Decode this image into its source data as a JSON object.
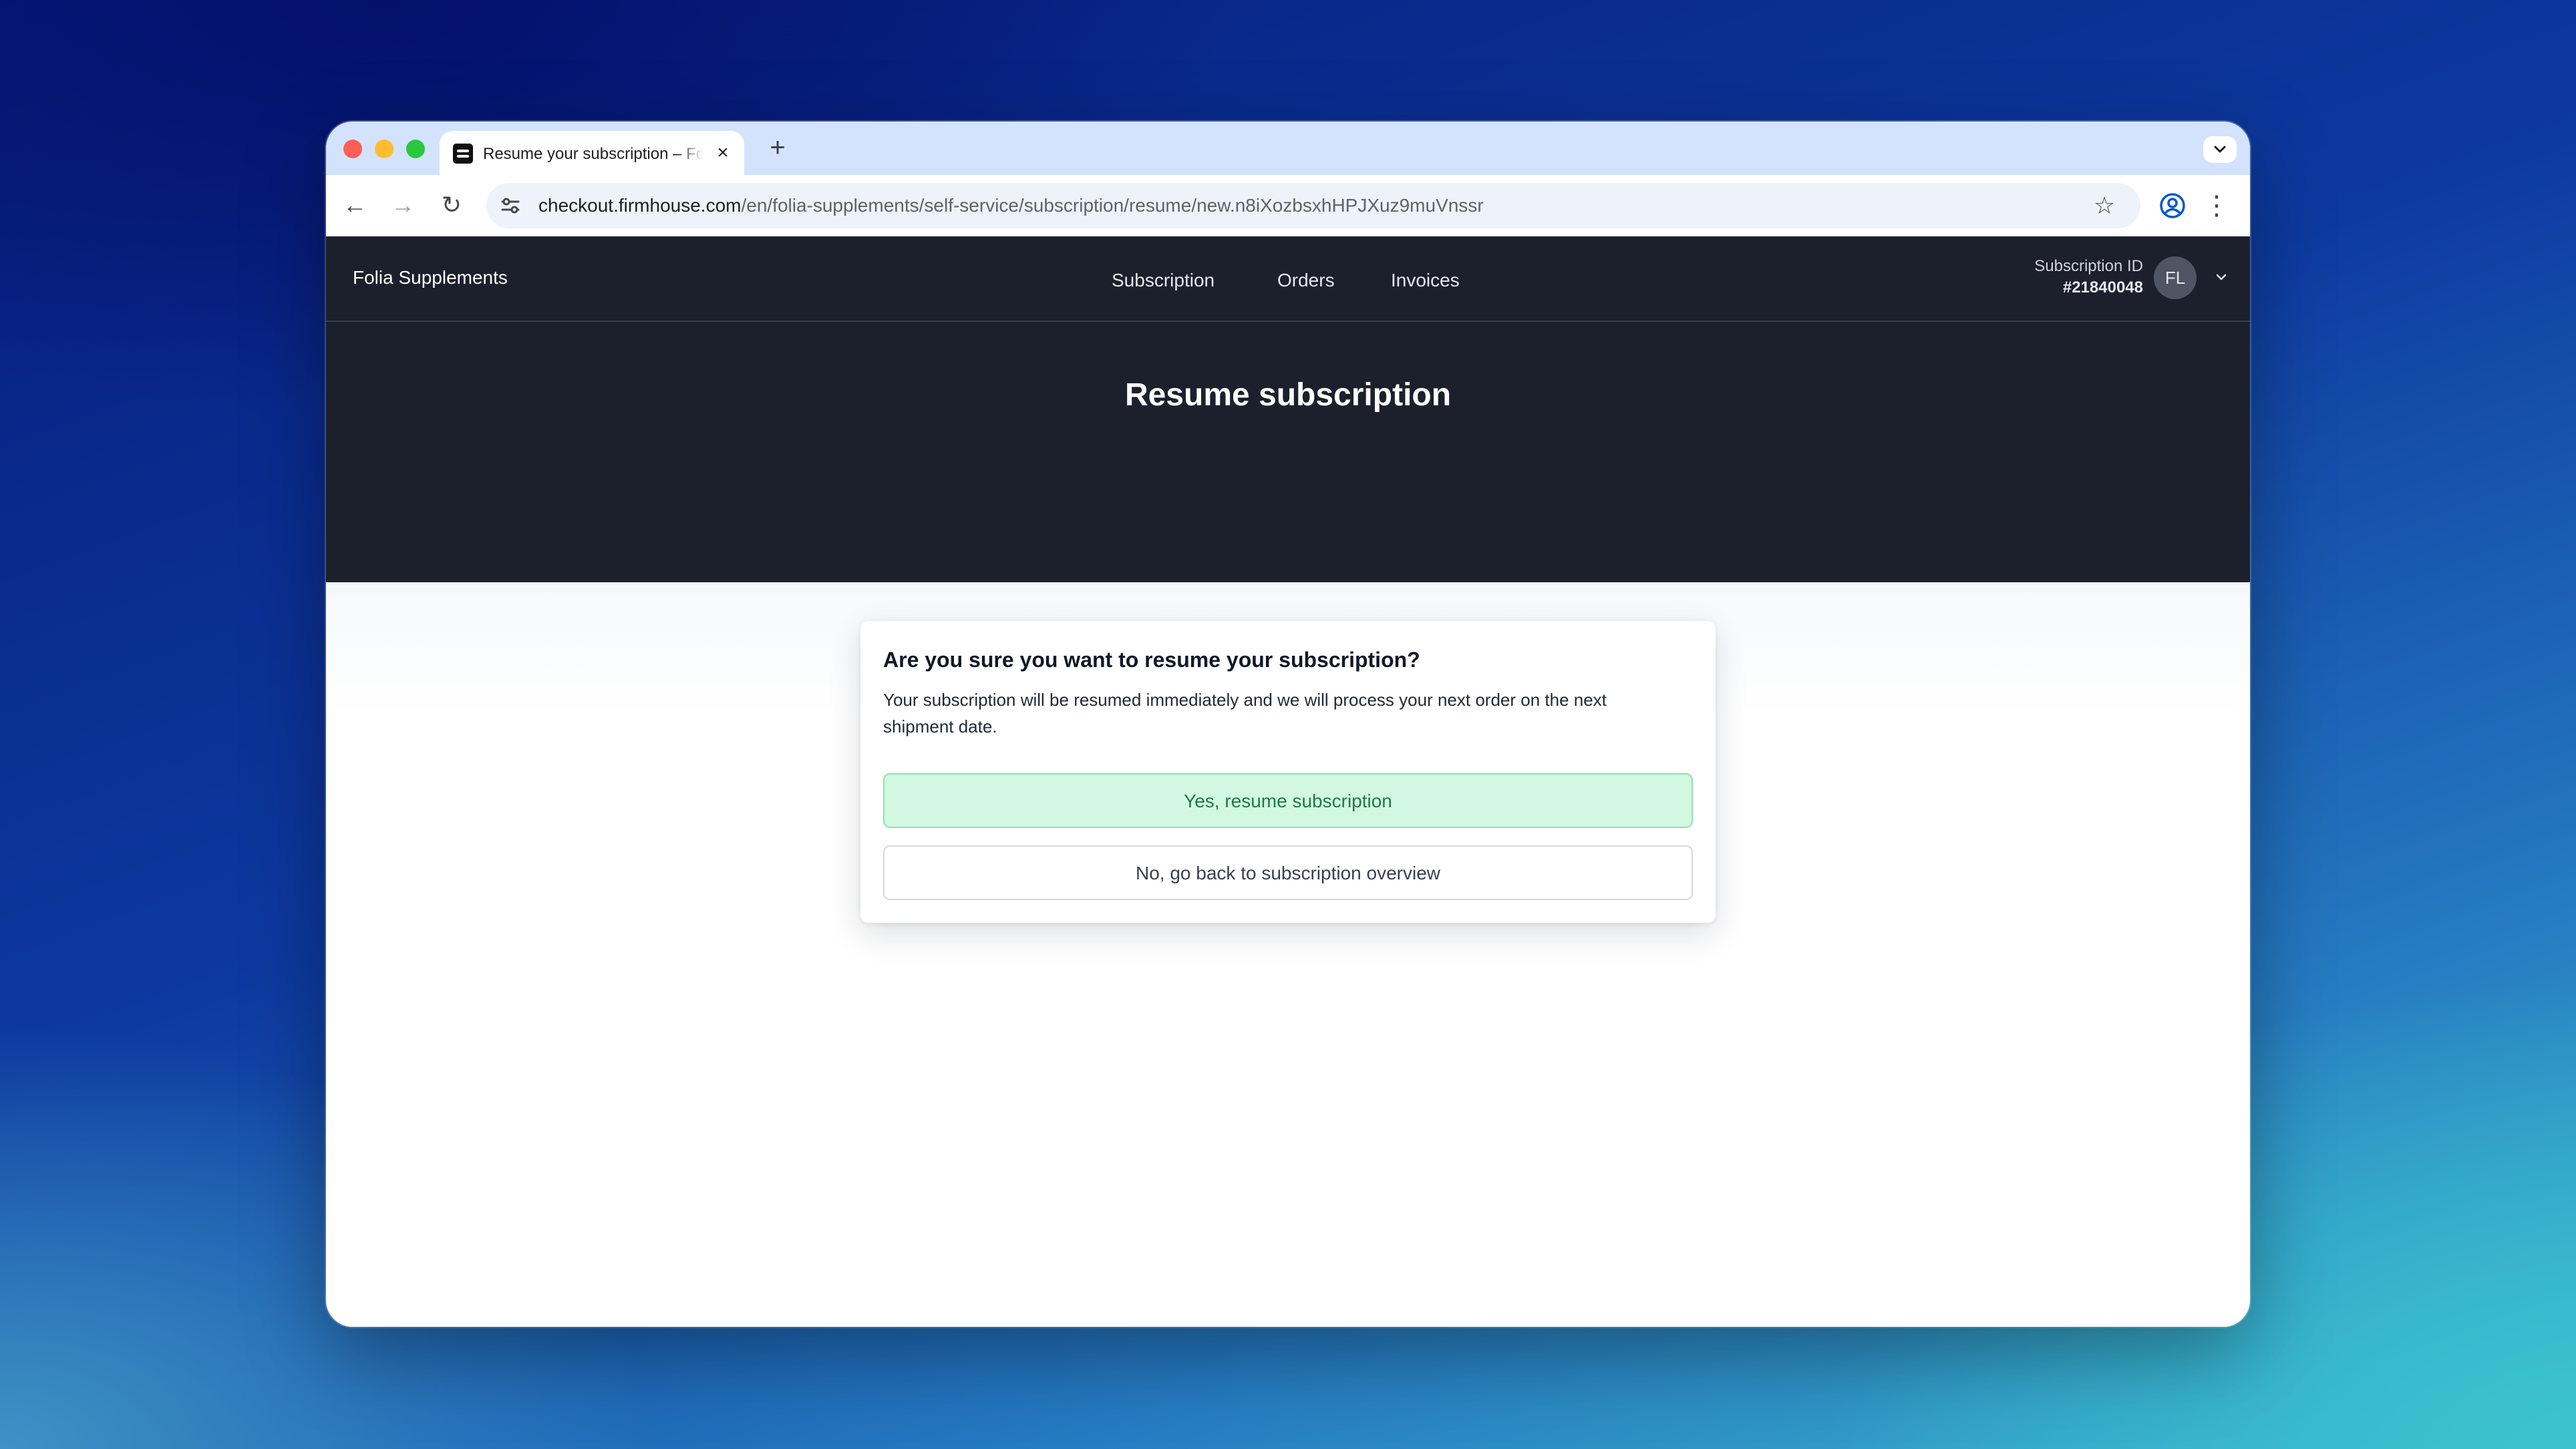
{
  "browser": {
    "tab": {
      "title": "Resume your subscription – Folia Supplements",
      "close": "×"
    },
    "new_tab": "+",
    "address": {
      "host": "checkout.firmhouse.com",
      "path": "/en/folia-supplements/self-service/subscription/resume/new.n8iXozbsxhHPJXuz9muVnssr"
    },
    "icons": {
      "back": "←",
      "forward": "→",
      "reload": "↻",
      "site_info": "⚙",
      "star": "☆",
      "menu": "⋮"
    }
  },
  "site": {
    "brand": "Folia Supplements",
    "nav": [
      {
        "label": "Subscription"
      },
      {
        "label": "Orders"
      },
      {
        "label": "Invoices"
      }
    ],
    "account": {
      "subscription_id_label": "Subscription ID",
      "subscription_id": "#21840048",
      "avatar_initials": "FL",
      "chevron": "⌄"
    }
  },
  "page": {
    "title": "Resume subscription",
    "dialog": {
      "heading": "Are you sure you want to resume your subscription?",
      "body": "Your subscription will be resumed immediately and we will process your next order on the next shipment date.",
      "confirm_label": "Yes, resume subscription",
      "cancel_label": "No, go back to subscription overview"
    }
  },
  "colors": {
    "header_bg": "#1c202d",
    "confirm_bg": "#d3f8e1",
    "confirm_text": "#1f7a47",
    "tabstrip_bg": "#d3e3fd"
  }
}
